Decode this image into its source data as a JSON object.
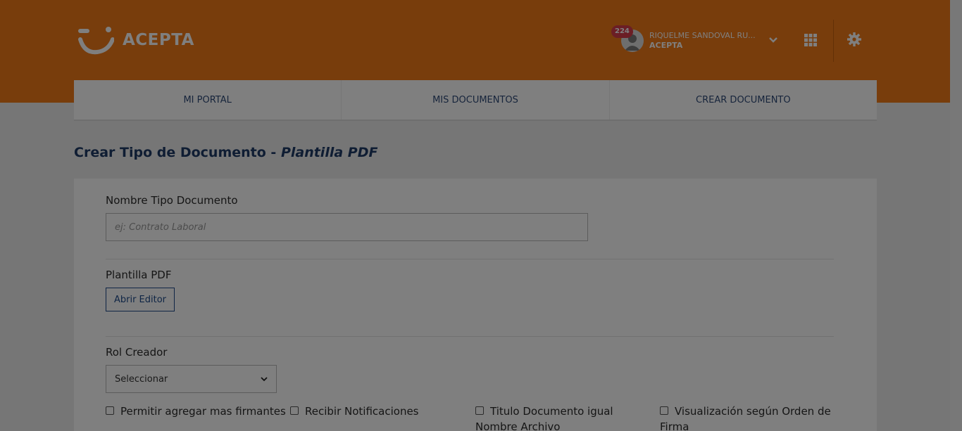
{
  "brand": {
    "name": "ACEPTA",
    "color": "#f07a19"
  },
  "user": {
    "notifications": "224",
    "name": "RIQUELME SANDOVAL RU...",
    "org": "ACEPTA"
  },
  "icons": {
    "apps": "grid-icon",
    "settings": "gear-icon",
    "dropdown": "chevron-down-icon",
    "avatar": "user-avatar"
  },
  "nav": {
    "items": [
      {
        "label": "MI PORTAL"
      },
      {
        "label": "MIS DOCUMENTOS"
      },
      {
        "label": "CREAR DOCUMENTO"
      }
    ]
  },
  "page": {
    "title": "Crear Tipo de Documento - ",
    "title_italic": "Plantilla PDF"
  },
  "form": {
    "name_label": "Nombre Tipo Documento",
    "name_placeholder": "ej: Contrato Laboral",
    "name_value": "",
    "template_label": "Plantilla PDF",
    "open_editor": "Abrir Editor",
    "role_label": "Rol Creador",
    "role_selected": "Seleccionar",
    "checkboxes": [
      {
        "line1": "Permitir agregar mas firmantes",
        "line2": "",
        "checked": false
      },
      {
        "line1": "Recibir Notificaciones",
        "line2": "",
        "checked": false
      },
      {
        "line1": "Titulo Documento igual",
        "line2": "Nombre Archivo",
        "checked": false
      },
      {
        "line1": "Visualización según Orden de",
        "line2": "Firma",
        "checked": false
      }
    ]
  }
}
